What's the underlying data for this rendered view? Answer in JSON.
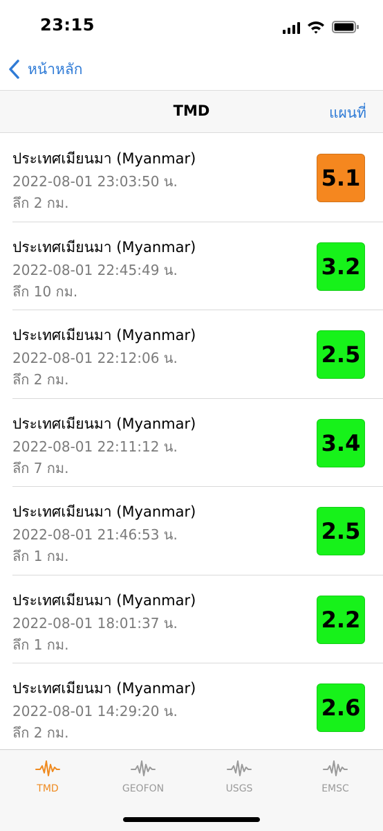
{
  "status_bar": {
    "time": "23:15",
    "icons": [
      "cellular-signal-icon",
      "wifi-icon",
      "battery-icon"
    ]
  },
  "nav": {
    "back_label": "หน้าหลัก",
    "title": "TMD",
    "map_label": "แผนที่"
  },
  "colors": {
    "accent": "#2f7bd6",
    "mag_high": "#f5871f",
    "mag_low": "#17f21a",
    "tab_active": "#ef8a1f",
    "tab_inactive": "#9a9a9a"
  },
  "quakes": [
    {
      "place": "ประเทศเมียนมา (Myanmar)",
      "time": "2022-08-01 23:03:50 น.",
      "depth": "ลึก 2 กม.",
      "magnitude": "5.1",
      "level": "moderate"
    },
    {
      "place": "ประเทศเมียนมา (Myanmar)",
      "time": "2022-08-01 22:45:49 น.",
      "depth": "ลึก 10 กม.",
      "magnitude": "3.2",
      "level": "minor"
    },
    {
      "place": "ประเทศเมียนมา (Myanmar)",
      "time": "2022-08-01 22:12:06 น.",
      "depth": "ลึก 2 กม.",
      "magnitude": "2.5",
      "level": "minor"
    },
    {
      "place": "ประเทศเมียนมา (Myanmar)",
      "time": "2022-08-01 22:11:12 น.",
      "depth": "ลึก 7 กม.",
      "magnitude": "3.4",
      "level": "minor"
    },
    {
      "place": "ประเทศเมียนมา (Myanmar)",
      "time": "2022-08-01 21:46:53 น.",
      "depth": "ลึก 1 กม.",
      "magnitude": "2.5",
      "level": "minor"
    },
    {
      "place": "ประเทศเมียนมา (Myanmar)",
      "time": "2022-08-01 18:01:37 น.",
      "depth": "ลึก 1 กม.",
      "magnitude": "2.2",
      "level": "minor"
    },
    {
      "place": "ประเทศเมียนมา (Myanmar)",
      "time": "2022-08-01 14:29:20 น.",
      "depth": "ลึก 2 กม.",
      "magnitude": "2.6",
      "level": "minor"
    }
  ],
  "tabs": [
    {
      "label": "TMD",
      "icon": "seismograph-icon",
      "active": true
    },
    {
      "label": "GEOFON",
      "icon": "seismograph-icon",
      "active": false
    },
    {
      "label": "USGS",
      "icon": "seismograph-icon",
      "active": false
    },
    {
      "label": "EMSC",
      "icon": "seismograph-icon",
      "active": false
    }
  ]
}
